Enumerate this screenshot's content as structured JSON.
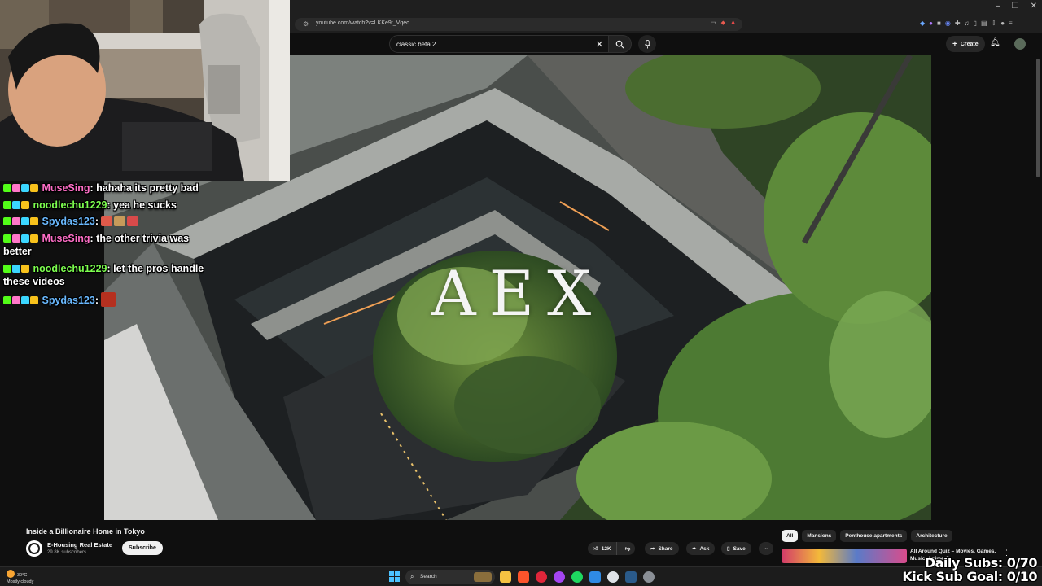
{
  "browser": {
    "url": "youtube.com/watch?v=LKKe9t_Vqec"
  },
  "header": {
    "search_value": "classic beta 2",
    "create_label": "Create"
  },
  "video": {
    "overlay_text": "AEX",
    "title": "Inside a Billionaire Home in Tokyo"
  },
  "channel": {
    "name": "E-Housing Real Estate",
    "subscribers": "29.8K subscribers",
    "subscribe_label": "Subscribe"
  },
  "actions": {
    "like_count": "12K",
    "share_label": "Share",
    "ask_label": "Ask",
    "save_label": "Save"
  },
  "chips": [
    {
      "label": "All",
      "active": true
    },
    {
      "label": "Mansions",
      "active": false
    },
    {
      "label": "Penthouse apartments",
      "active": false
    },
    {
      "label": "Architecture",
      "active": false
    }
  ],
  "recommendation": {
    "title": "All Around Quiz – Movies, Games, Music, Anime Q..."
  },
  "chat": [
    {
      "user": "MuseSing",
      "message": "hahaha its pretty bad",
      "color": "#ff6ec7"
    },
    {
      "user": "noodlechu1229",
      "message": "yea he sucks",
      "color": "#7dff4f"
    },
    {
      "user": "Spydas123",
      "message": "",
      "color": "#6ab9ff"
    },
    {
      "user": "MuseSing",
      "message": "the other trivia was better",
      "color": "#ff6ec7"
    },
    {
      "user": "noodlechu1229",
      "message": "let the pros handle these videos",
      "color": "#7dff4f"
    },
    {
      "user": "Spydas123",
      "message": "",
      "color": "#6ab9ff"
    }
  ],
  "taskbar": {
    "temperature": "30°C",
    "weather": "Mostly cloudy",
    "search_label": "Search"
  },
  "stream_overlay": {
    "daily_subs": "Daily Subs: 0/70",
    "kick_goal": "Kick Sub Goal: 0/10"
  }
}
